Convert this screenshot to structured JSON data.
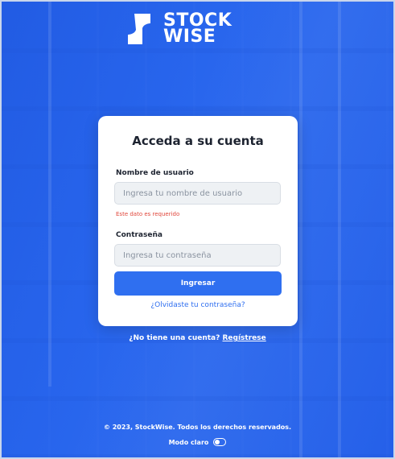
{
  "brand": {
    "line1": "STOCK",
    "line2": "WISE"
  },
  "login": {
    "title": "Acceda a su cuenta",
    "username_label": "Nombre de usuario",
    "username_placeholder": "Ingresa tu nombre de usuario",
    "username_error": "Este dato es requerido",
    "password_label": "Contraseña",
    "password_placeholder": "Ingresa tu contraseña",
    "submit_label": "Ingresar",
    "forgot_link": "¿Olvidaste tu contraseña?"
  },
  "signup": {
    "prompt": "¿No tiene una cuenta?",
    "link": "Regístrese"
  },
  "footer": {
    "copyright": "© 2023, StockWise. Todos los derechos reservados.",
    "mode_label": "Modo claro"
  },
  "colors": {
    "accent": "#2f6ff0",
    "error": "#e0463b"
  }
}
